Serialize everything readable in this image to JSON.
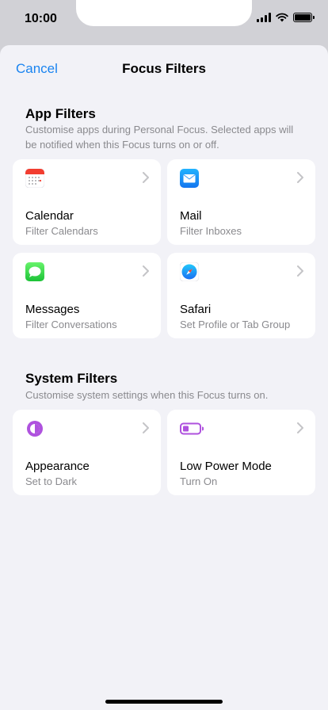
{
  "status": {
    "time": "10:00"
  },
  "nav": {
    "cancel_label": "Cancel",
    "title": "Focus Filters"
  },
  "app_filters": {
    "title": "App Filters",
    "description": "Customise apps during Personal Focus. Selected apps will be notified when this Focus turns on or off.",
    "cards": [
      {
        "label": "Calendar",
        "sub": "Filter Calendars",
        "icon": "calendar-icon"
      },
      {
        "label": "Mail",
        "sub": "Filter Inboxes",
        "icon": "mail-icon"
      },
      {
        "label": "Messages",
        "sub": "Filter Conversations",
        "icon": "messages-icon"
      },
      {
        "label": "Safari",
        "sub": "Set Profile or Tab Group",
        "icon": "safari-icon"
      }
    ]
  },
  "system_filters": {
    "title": "System Filters",
    "description": "Customise system settings when this Focus turns on.",
    "cards": [
      {
        "label": "Appearance",
        "sub": "Set to Dark",
        "icon": "appearance-icon"
      },
      {
        "label": "Low Power Mode",
        "sub": "Turn On",
        "icon": "low-power-mode-icon"
      }
    ]
  },
  "colors": {
    "accent": "#1a84f0",
    "background": "#f2f2f7",
    "card": "#ffffff",
    "secondary_text": "#8a8a8e",
    "system_purple": "#af52de"
  }
}
